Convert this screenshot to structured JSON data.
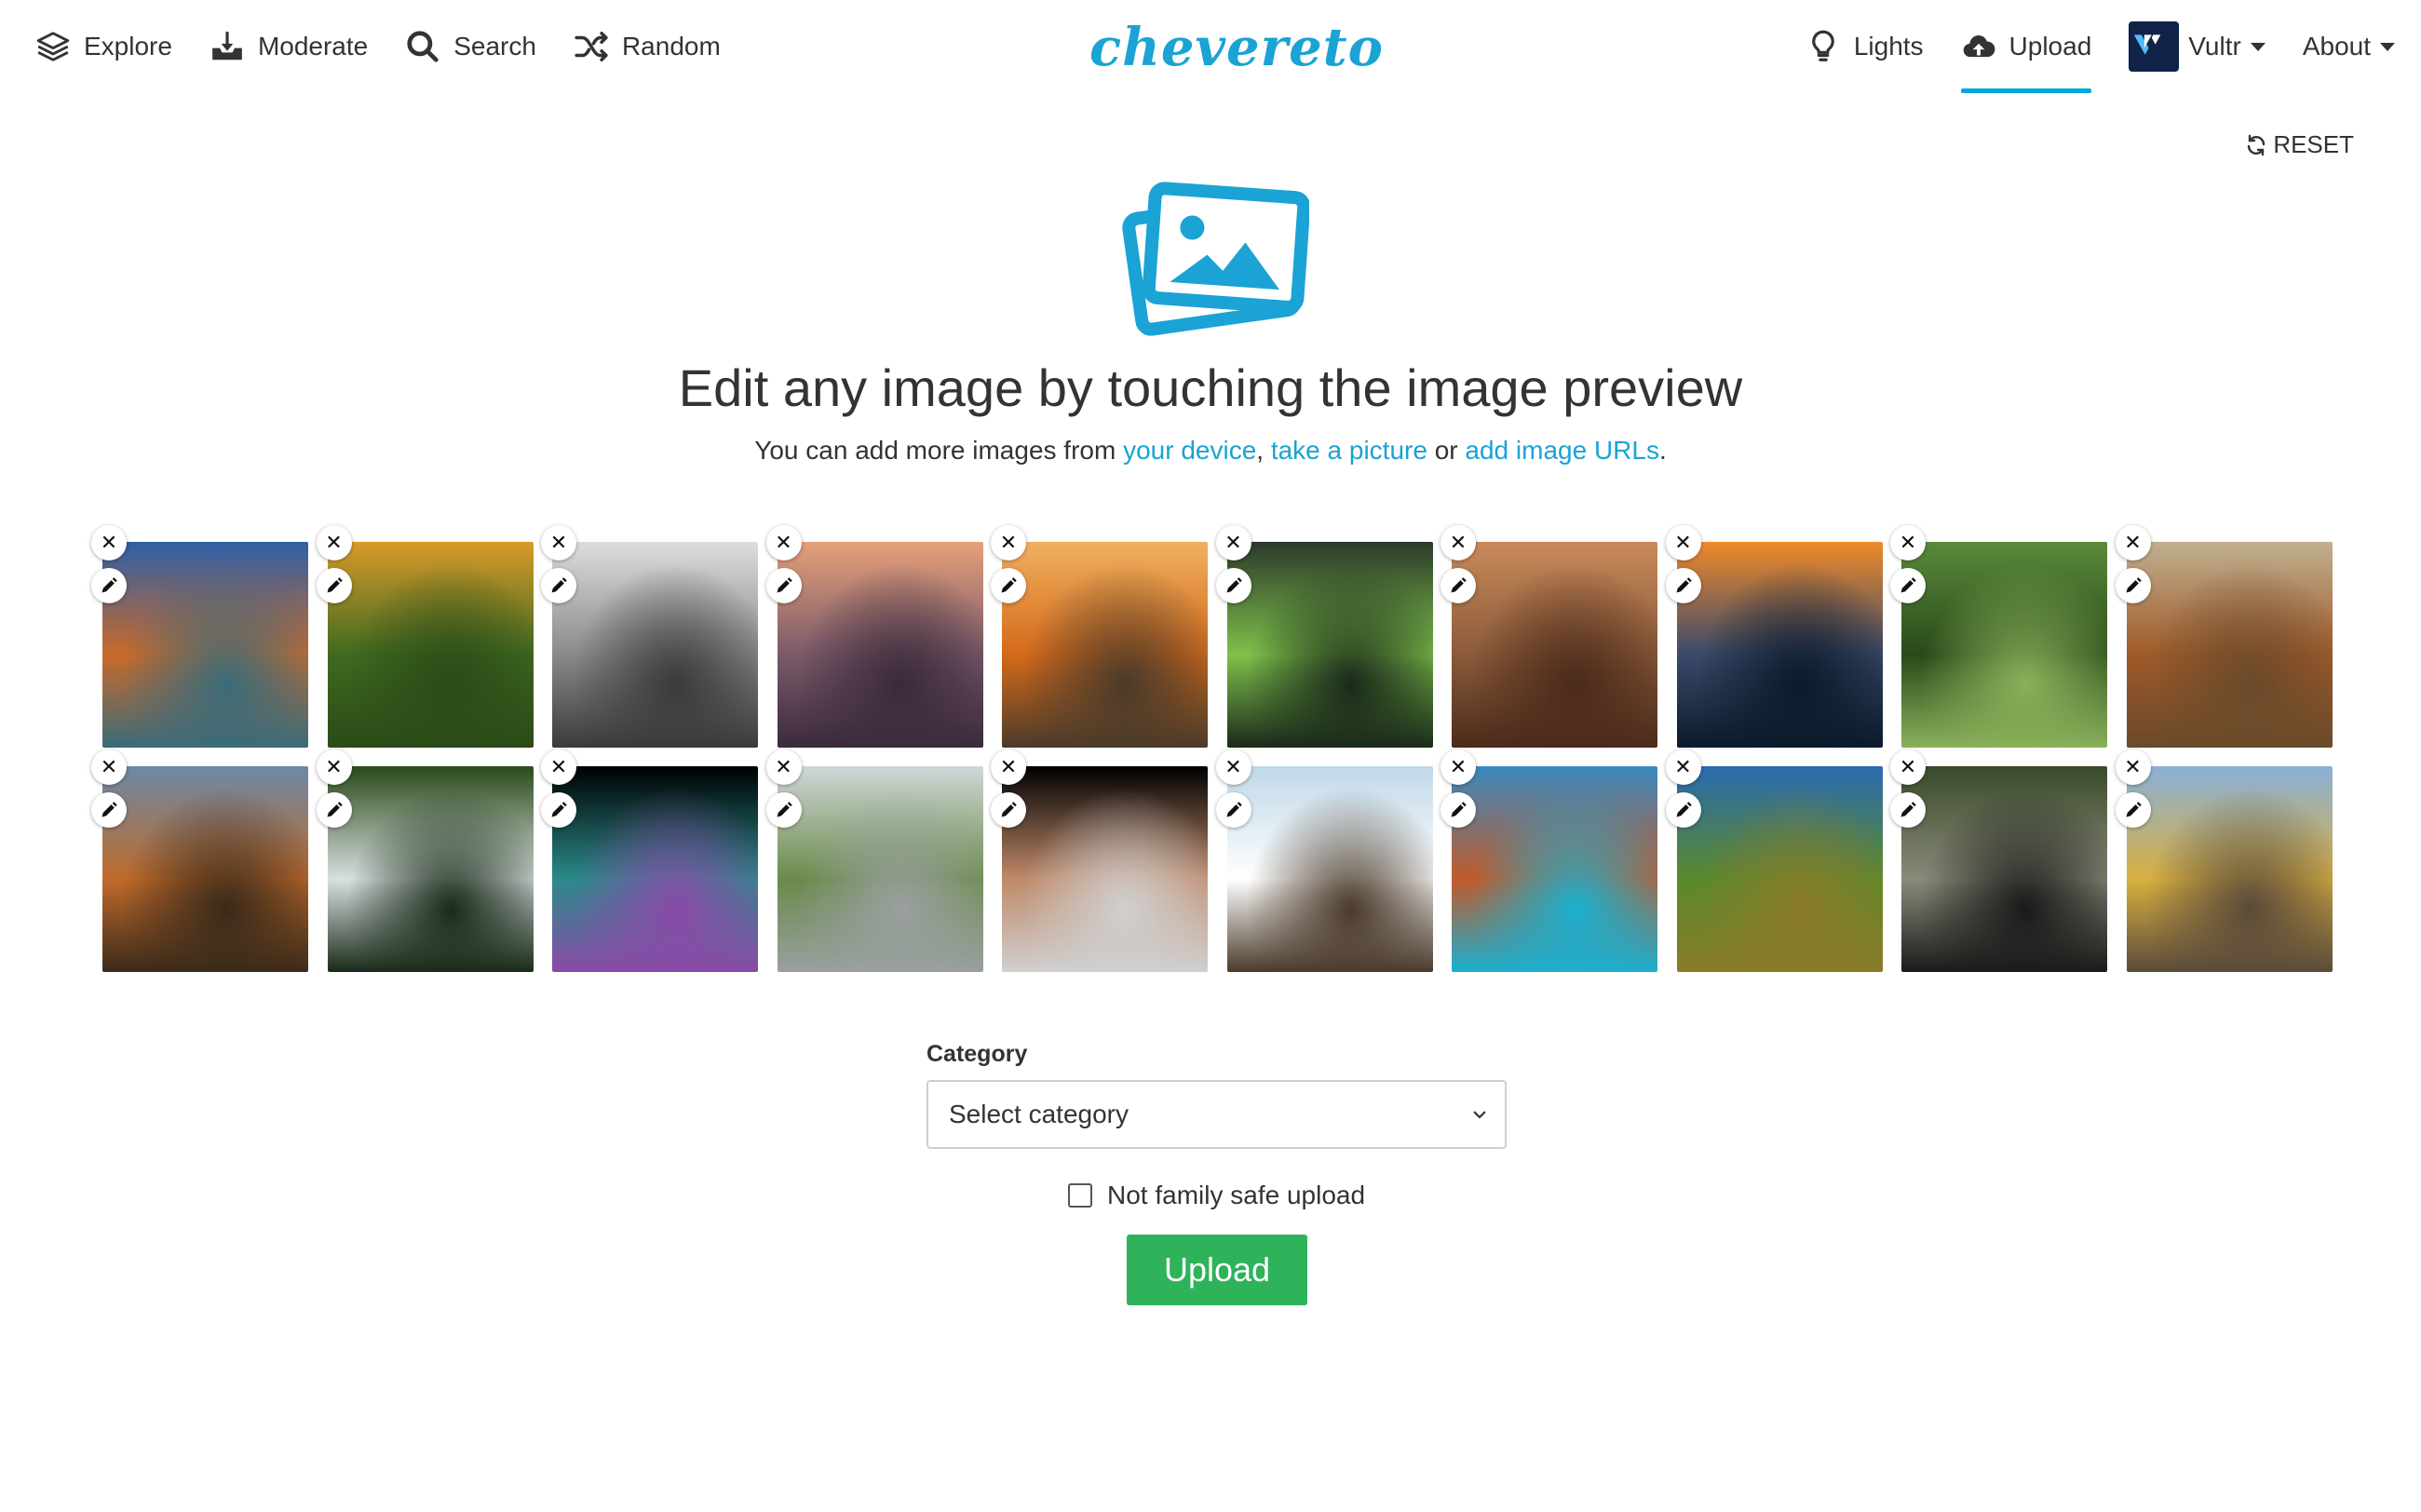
{
  "nav": {
    "left": [
      {
        "label": "Explore",
        "icon": "layers-icon"
      },
      {
        "label": "Moderate",
        "icon": "inbox-download-icon"
      },
      {
        "label": "Search",
        "icon": "search-icon"
      },
      {
        "label": "Random",
        "icon": "shuffle-icon"
      }
    ],
    "logo": "chevereto",
    "right": {
      "lights": "Lights",
      "upload": "Upload",
      "vultr": "Vultr",
      "about": "About"
    }
  },
  "reset_label": "RESET",
  "headline": "Edit any image by touching the image preview",
  "subline": {
    "prefix": "You can add more images from ",
    "link_device": "your device",
    "sep1": ", ",
    "link_camera": "take a picture",
    "sep2": " or ",
    "link_urls": "add image URLs",
    "suffix": "."
  },
  "accent_color": "#1aa3d4",
  "upload_button_color": "#2eb35a",
  "thumbnails": [
    {
      "subject": "mountain lake at sunset",
      "colors": [
        "#2f5fa8",
        "#c86a2a",
        "#3a6b7a"
      ]
    },
    {
      "subject": "green hedge maze",
      "colors": [
        "#d99a2a",
        "#3f6a1f",
        "#2b4a18"
      ]
    },
    {
      "subject": "stone gargoyles black and white",
      "colors": [
        "#dddddd",
        "#8a8a8a",
        "#3a3a3a"
      ]
    },
    {
      "subject": "castle ruins in fog",
      "colors": [
        "#e6a07a",
        "#7a5a6a",
        "#3a2a3a"
      ]
    },
    {
      "subject": "pumpkin field at dusk",
      "colors": [
        "#f0b060",
        "#d46a1a",
        "#4a3a2a"
      ]
    },
    {
      "subject": "chameleon on branch",
      "colors": [
        "#2a3a2a",
        "#7fc04a",
        "#1a2a1a"
      ]
    },
    {
      "subject": "cliff temple with prayer flags",
      "colors": [
        "#c98a5a",
        "#8a5a3a",
        "#4a2a1a"
      ]
    },
    {
      "subject": "alpine village lake",
      "colors": [
        "#f08a2a",
        "#3a4a6a",
        "#0a1a2a"
      ]
    },
    {
      "subject": "aerial green fields",
      "colors": [
        "#5a8a3a",
        "#2a4a1a",
        "#8ab05a"
      ]
    },
    {
      "subject": "red fox in grass",
      "colors": [
        "#c0b090",
        "#a05a2a",
        "#6a4a2a"
      ]
    },
    {
      "subject": "autumn lake hills",
      "colors": [
        "#6a8aa8",
        "#c06a2a",
        "#3a2a1a"
      ]
    },
    {
      "subject": "mossy stream rocks",
      "colors": [
        "#2a4a1a",
        "#d8e0e0",
        "#1a2a1a"
      ]
    },
    {
      "subject": "iridescent wing macro",
      "colors": [
        "#000000",
        "#2a8a8a",
        "#8a4aa8"
      ]
    },
    {
      "subject": "misty valley",
      "colors": [
        "#d0d8d8",
        "#6a8a4a",
        "#9aa0a0"
      ]
    },
    {
      "subject": "jupiter and moon",
      "colors": [
        "#000000",
        "#c08a6a",
        "#d0d0d0"
      ]
    },
    {
      "subject": "brown bear in waterfall",
      "colors": [
        "#c0d8e8",
        "#ffffff",
        "#4a3a2a"
      ]
    },
    {
      "subject": "snowy mountain blue river",
      "colors": [
        "#3a8ac0",
        "#c05a2a",
        "#1ab0d0"
      ]
    },
    {
      "subject": "vineyard by lake",
      "colors": [
        "#2a6ab0",
        "#5a8a2a",
        "#8a7a2a"
      ]
    },
    {
      "subject": "waterfall canyon",
      "colors": [
        "#3a4a2a",
        "#8a8a7a",
        "#1a1a1a"
      ]
    },
    {
      "subject": "castle on golden hill",
      "colors": [
        "#8ab0d8",
        "#d8b040",
        "#5a4a3a"
      ]
    }
  ],
  "form": {
    "category_label": "Category",
    "category_value": "Select category",
    "nsfw_label": "Not family safe upload",
    "nsfw_checked": false,
    "upload_label": "Upload"
  }
}
